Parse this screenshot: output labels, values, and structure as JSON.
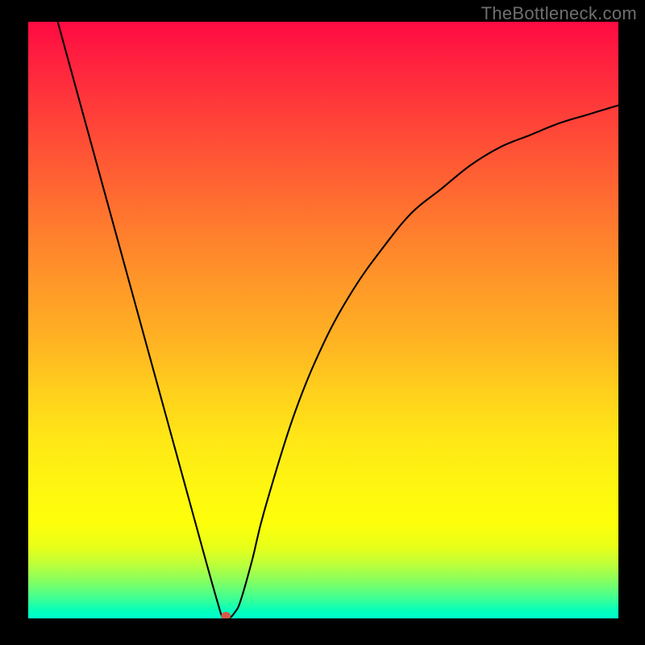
{
  "watermark": "TheBottleneck.com",
  "chart_data": {
    "type": "line",
    "title": "",
    "xlabel": "",
    "ylabel": "",
    "xlim": [
      0,
      100
    ],
    "ylim": [
      0,
      100
    ],
    "background_gradient": {
      "top": "#ff0a42",
      "middle": "#ffe716",
      "bottom": "#00ffc8"
    },
    "series": [
      {
        "name": "bottleneck-curve",
        "x": [
          5,
          10,
          15,
          20,
          25,
          30,
          32,
          33,
          34,
          35,
          36,
          38,
          40,
          45,
          50,
          55,
          60,
          65,
          70,
          75,
          80,
          85,
          90,
          95,
          100
        ],
        "y": [
          100,
          82,
          64,
          46,
          28,
          10,
          3,
          0,
          0,
          1,
          3,
          10,
          18,
          34,
          46,
          55,
          62,
          68,
          72,
          76,
          79,
          81,
          83,
          84.5,
          86
        ],
        "color": "#000000"
      }
    ],
    "marker": {
      "name": "optimum-point",
      "x": 33.5,
      "y": 0,
      "color": "#d45a4a",
      "size": 6
    },
    "grid": false,
    "legend": false
  }
}
